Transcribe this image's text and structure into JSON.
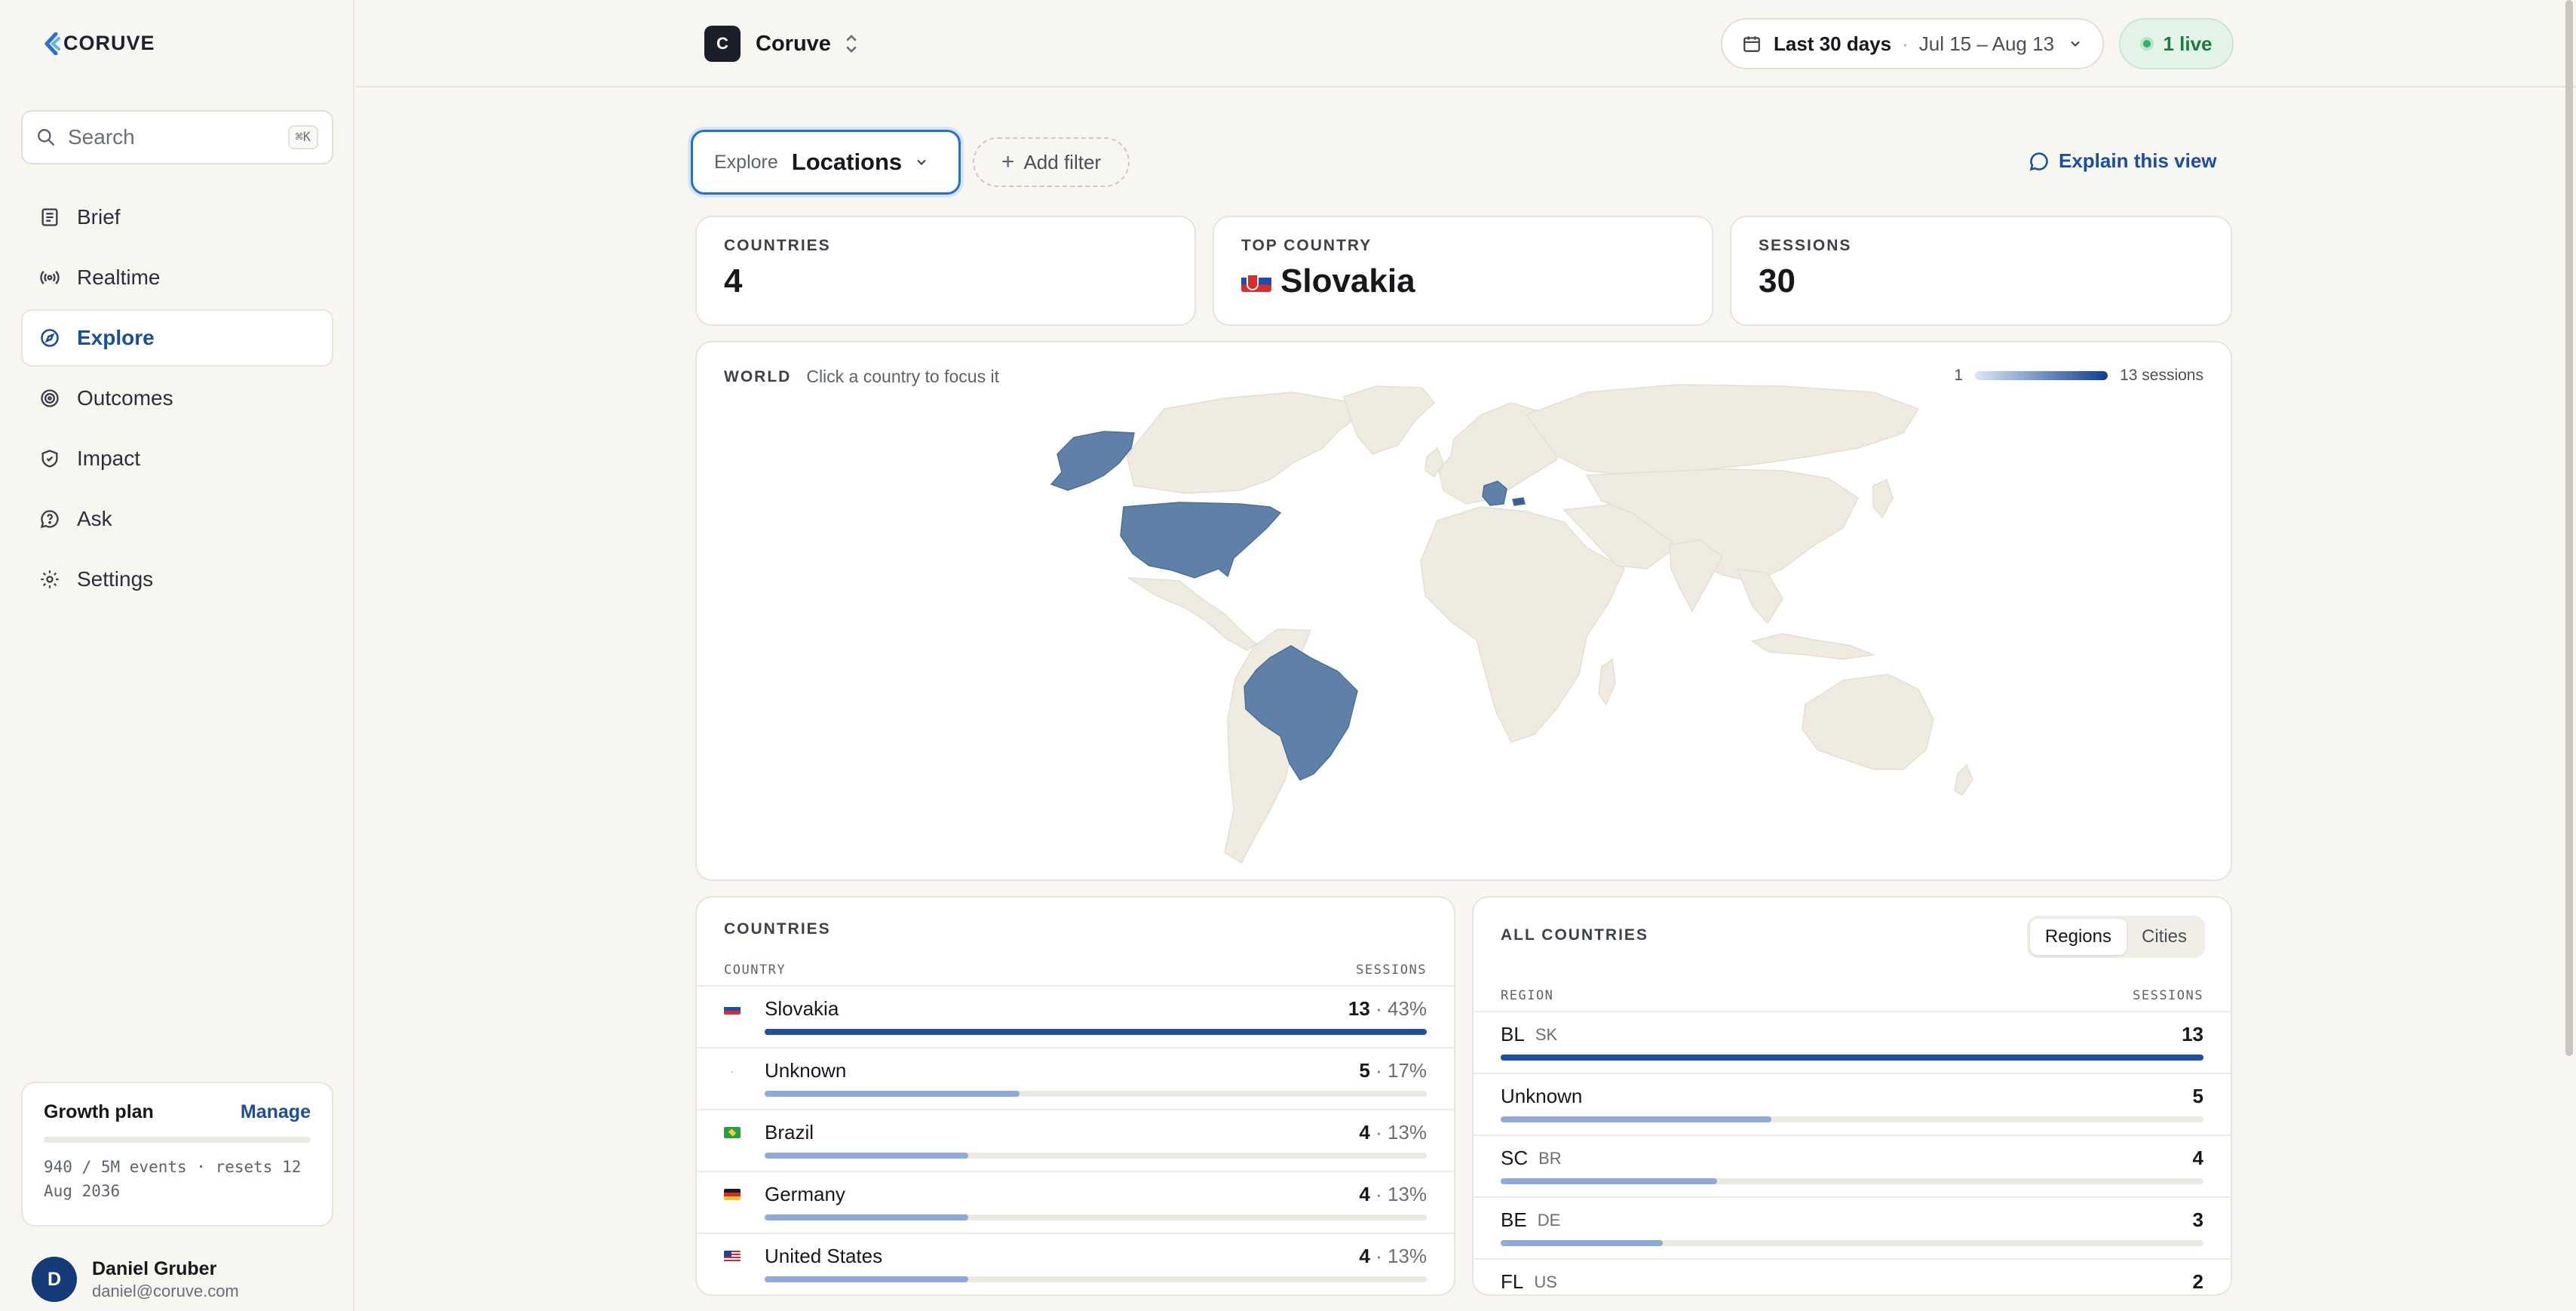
{
  "app": {
    "logo_text": "CORUVE"
  },
  "sidebar": {
    "search_placeholder": "Search",
    "search_shortcut": "⌘K",
    "items": [
      {
        "label": "Brief",
        "icon": "newspaper-icon"
      },
      {
        "label": "Realtime",
        "icon": "broadcast-icon"
      },
      {
        "label": "Explore",
        "icon": "compass-icon",
        "active": true
      },
      {
        "label": "Outcomes",
        "icon": "target-icon"
      },
      {
        "label": "Impact",
        "icon": "shield-icon"
      },
      {
        "label": "Ask",
        "icon": "help-bubble-icon"
      },
      {
        "label": "Settings",
        "icon": "gear-icon"
      }
    ],
    "plan": {
      "title": "Growth plan",
      "manage": "Manage",
      "usage": "940 / 5M events · resets 12 Aug 2036",
      "usage_fraction": 0.0002
    },
    "user": {
      "initial": "D",
      "name": "Daniel Gruber",
      "email": "daniel@coruve.com"
    }
  },
  "topbar": {
    "workspace_badge": "C",
    "workspace_name": "Coruve",
    "date_label": "Last 30 days",
    "date_range": "Jul 15 – Aug 13",
    "live": "1 live"
  },
  "toolbar": {
    "explore_key": "Explore",
    "explore_value": "Locations",
    "add_filter": "Add filter",
    "explain": "Explain this view"
  },
  "stats": [
    {
      "label": "COUNTRIES",
      "value": "4"
    },
    {
      "label": "TOP COUNTRY",
      "value": "Slovakia",
      "flag": "sk"
    },
    {
      "label": "SESSIONS",
      "value": "30"
    }
  ],
  "map": {
    "title": "WORLD",
    "hint": "Click a country to focus it",
    "legend_min": "1",
    "legend_max": "13 sessions",
    "colors": {
      "land": "#efebe1",
      "highlight": "#5f81a8",
      "highlight_dark": "#45678f"
    }
  },
  "countries_table": {
    "title": "COUNTRIES",
    "col_country": "COUNTRY",
    "col_sessions": "SESSIONS",
    "rows": [
      {
        "name": "Slovakia",
        "flag": "sk",
        "count": "13",
        "pct": "43%",
        "fraction": 1.0
      },
      {
        "name": "Unknown",
        "flag": "none",
        "count": "5",
        "pct": "17%",
        "fraction": 0.385
      },
      {
        "name": "Brazil",
        "flag": "br",
        "count": "4",
        "pct": "13%",
        "fraction": 0.308
      },
      {
        "name": "Germany",
        "flag": "de",
        "count": "4",
        "pct": "13%",
        "fraction": 0.308
      },
      {
        "name": "United States",
        "flag": "us",
        "count": "4",
        "pct": "13%",
        "fraction": 0.308
      }
    ]
  },
  "regions_table": {
    "title": "ALL COUNTRIES",
    "tab_regions": "Regions",
    "tab_cities": "Cities",
    "col_region": "REGION",
    "col_sessions": "SESSIONS",
    "rows": [
      {
        "region": "BL",
        "country": "SK",
        "count": "13",
        "fraction": 1.0
      },
      {
        "region": "Unknown",
        "country": "",
        "count": "5",
        "fraction": 0.385
      },
      {
        "region": "SC",
        "country": "BR",
        "count": "4",
        "fraction": 0.308
      },
      {
        "region": "BE",
        "country": "DE",
        "count": "3",
        "fraction": 0.231
      },
      {
        "region": "FL",
        "country": "US",
        "count": "2",
        "fraction": 0.154
      }
    ]
  },
  "colors": {
    "accent": "#1a4fa0",
    "bar_primary": "#1f4fa3",
    "bar_secondary": "#8eaad6"
  }
}
